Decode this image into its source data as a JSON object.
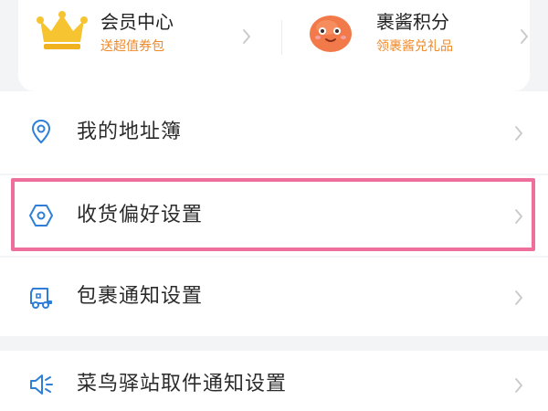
{
  "member_card": {
    "membership": {
      "title": "会员中心",
      "subtitle": "送超值券包",
      "icon": "crown-icon"
    },
    "points": {
      "title": "裹酱积分",
      "subtitle": "领裹酱兑礼品",
      "icon": "mascot-icon"
    },
    "subtitle_color": "#ef8a2b"
  },
  "menu": {
    "items": [
      {
        "label": "我的地址簿",
        "icon": "location-pin-icon"
      },
      {
        "label": "收货偏好设置",
        "icon": "hexagon-icon"
      },
      {
        "label": "包裹通知设置",
        "icon": "delivery-truck-icon"
      }
    ],
    "station": {
      "label": "菜鸟驿站取件通知设置",
      "icon": "speaker-icon"
    }
  },
  "colors": {
    "accent_icon": "#2f7fd8",
    "highlight": "#ee6f9b",
    "background": "#f3f4f6"
  }
}
